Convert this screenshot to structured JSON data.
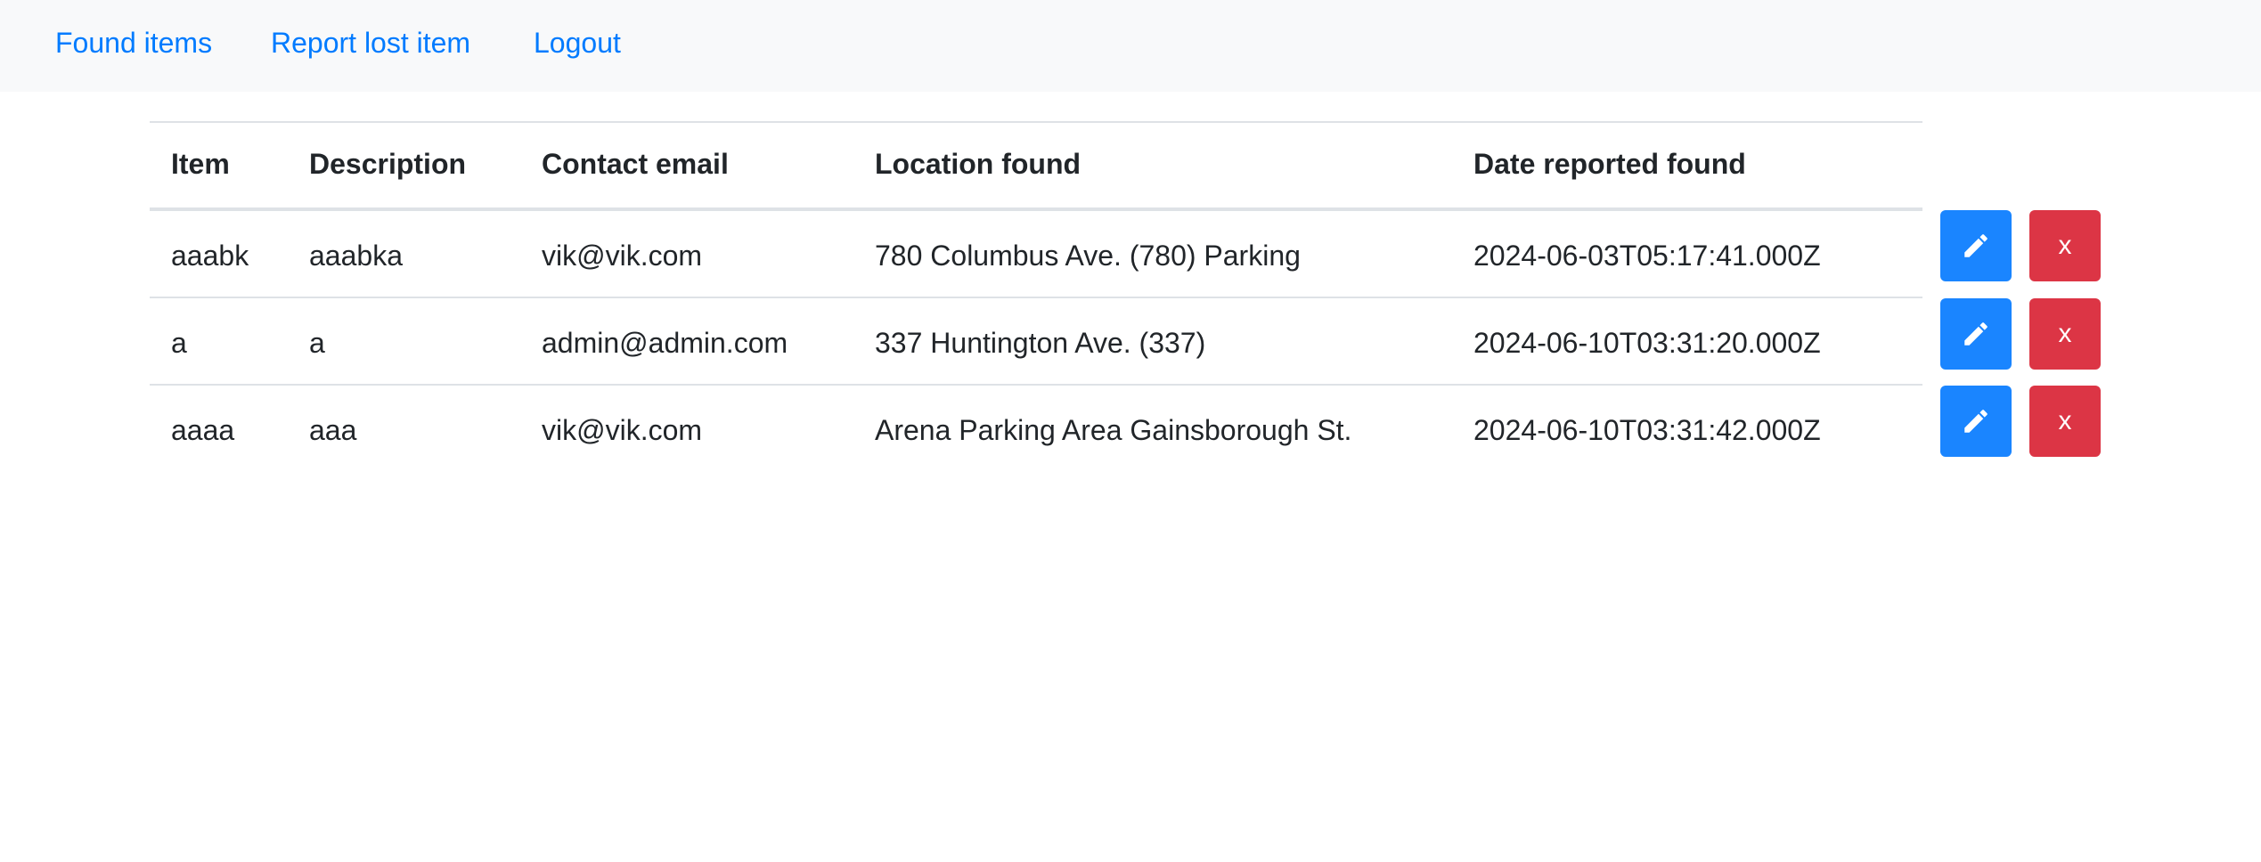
{
  "nav": {
    "found_items": "Found items",
    "report_lost_item": "Report lost item",
    "logout": "Logout"
  },
  "table": {
    "headers": [
      "Item",
      "Description",
      "Contact email",
      "Location found",
      "Date reported found"
    ],
    "rows": [
      {
        "item": "aaabk",
        "description": "aaabka",
        "email": "vik@vik.com",
        "location": "780 Columbus Ave. (780) Parking",
        "date": "2024-06-03T05:17:41.000Z"
      },
      {
        "item": "a",
        "description": "a",
        "email": "admin@admin.com",
        "location": "337 Huntington Ave. (337)",
        "date": "2024-06-10T03:31:20.000Z"
      },
      {
        "item": "aaaa",
        "description": "aaa",
        "email": "vik@vik.com",
        "location": "Arena Parking Area Gainsborough St.",
        "date": "2024-06-10T03:31:42.000Z"
      }
    ]
  },
  "actions": {
    "edit_icon": "pencil-icon",
    "delete_label": "x"
  },
  "colors": {
    "link": "#007bff",
    "edit_button": "#1a85ff",
    "delete_button": "#dc3545",
    "navbar_bg": "#f8f9fa"
  }
}
